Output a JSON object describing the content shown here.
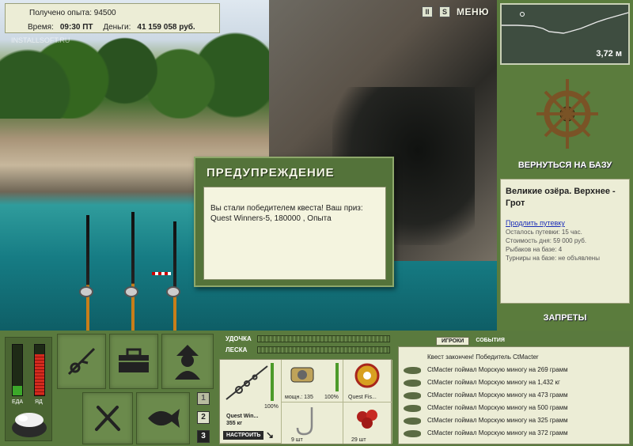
{
  "info": {
    "experience_label": "Получено опыта:",
    "experience_value": "94500",
    "time_label": "Время:",
    "time_value": "09:30 ПТ",
    "money_label": "Деньги:",
    "money_value": "41 159 058 руб."
  },
  "watermark": "INSTALLSOFT.RU",
  "top_buttons": {
    "btn1": "II",
    "btn2": "S",
    "menu": "МЕНЮ"
  },
  "depth": {
    "value": "3,72 м"
  },
  "right_panel": {
    "return_label": "ВЕРНУТЬСЯ НА БАЗУ",
    "location_title": "Великие озёра. Верхнее - Грот",
    "extend_link": "Продлить путевку",
    "lines": [
      "Осталось путевки: 15 час.",
      "Стоимость дня: 59 000 руб.",
      "Рыбаков на базе: 4",
      "Турниры на базе: не объявлены"
    ],
    "bans_label": "ЗАПРЕТЫ"
  },
  "dialog": {
    "title": "ПРЕДУПРЕЖДЕНИЕ",
    "message": "Вы стали победителем квеста! Ваш приз: Quest Winners-5, 180000 , Опыта"
  },
  "meters": {
    "food_label": "ЕДА",
    "poison_label": "ЯД",
    "food_level": 0.18,
    "poison_level": 0.82
  },
  "pager": [
    "1",
    "2",
    "3"
  ],
  "tackle": {
    "rod_label": "УДОЧКА",
    "line_label": "ЛЕСКА",
    "rod_name": "Quest Win...",
    "rod_weight": "355 кг",
    "rod_percent": "100%",
    "adjust_button": "НАСТРОИТЬ",
    "reel_power": "мощн.: 135",
    "reel_percent": "100%",
    "line_name": "Quest Fis...",
    "hook_count": "9 шт",
    "bait_count": "29 шт"
  },
  "events": {
    "tab_players": "ИГРОКИ",
    "tab_events": "СОБЫТИЯ",
    "header": "Квест закончен! Победитель CtMacter",
    "rows": [
      "CtMacter поймал Морскую миногу на 269 грамм",
      "CtMacter поймал Морскую миногу на 1,432 кг",
      "CtMacter поймал Морскую миногу на 473 грамм",
      "CtMacter поймал Морскую миногу на 500 грамм",
      "CtMacter поймал Морскую миногу на 325 грамм",
      "CtMacter поймал Морскую миногу на 372 грамм"
    ]
  }
}
